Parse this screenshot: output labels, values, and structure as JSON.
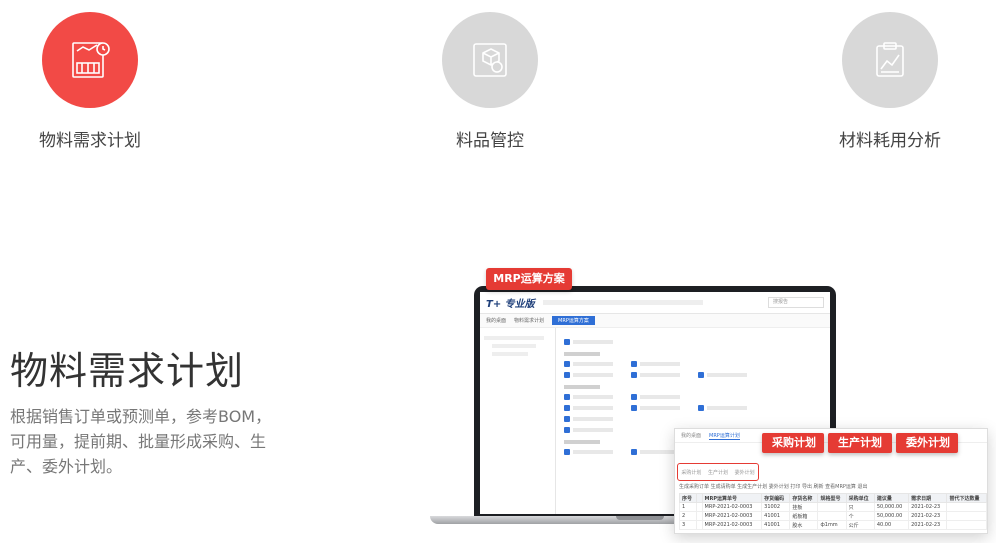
{
  "features": [
    {
      "label": "物料需求计划",
      "icon": "document-chart-icon",
      "active": true
    },
    {
      "label": "料品管控",
      "icon": "box-settings-icon",
      "active": false
    },
    {
      "label": "材料耗用分析",
      "icon": "clipboard-chart-icon",
      "active": false
    }
  ],
  "main": {
    "title": "物料需求计划",
    "description": "根据销售订单或预测单，参考BOM，可用量，提前期、批量形成采购、生产、委外计划。"
  },
  "laptop": {
    "banner": "MRP运算方案",
    "app_logo": "T+ 专业版",
    "search": "搜报告",
    "tabs": [
      "我的桌面",
      "物料需求计划",
      "MRP运算方案"
    ]
  },
  "popup": {
    "tabs": [
      "我的桌面",
      "MRP运算计划"
    ],
    "subtabs": [
      "采购计划",
      "生产计划",
      "委外计划"
    ],
    "toolbar": "生成采购订单  生成请购单  生成生产计划  委外计划  打印  导出  刷新  查看MRP运算  退出",
    "headers": [
      "序号",
      "",
      "MRP运算单号",
      "存货编码",
      "存货名称",
      "规格型号",
      "采购单位",
      "建议量",
      "需求日期",
      "替代下达数量"
    ],
    "rows": [
      [
        "1",
        "",
        "MRP-2021-02-0003",
        "31002",
        "挂板",
        "",
        "只",
        "50,000.00",
        "2021-02-23",
        ""
      ],
      [
        "2",
        "",
        "MRP-2021-02-0003",
        "41001",
        "纸板箱",
        "",
        "个",
        "50,000.00",
        "2021-02-23",
        ""
      ],
      [
        "3",
        "",
        "MRP-2021-02-0003",
        "41001",
        "胶水",
        "ф1mm",
        "公斤",
        "40.00",
        "2021-02-23",
        ""
      ]
    ]
  },
  "plan_buttons": [
    "采购计划",
    "生产计划",
    "委外计划"
  ],
  "colors": {
    "accent": "#f24a46",
    "inactive": "#d8d8d8",
    "blue": "#2f6fd6"
  }
}
